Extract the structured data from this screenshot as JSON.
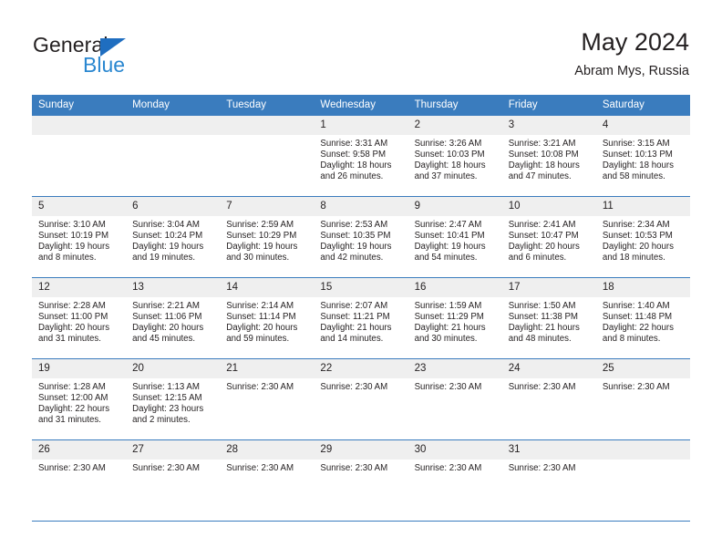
{
  "brand": {
    "word_one": "General",
    "word_two": "Blue",
    "triangle_color": "#1f6ec0",
    "blue_color": "#2a87d0"
  },
  "header": {
    "title": "May 2024",
    "subtitle": "Abram Mys, Russia"
  },
  "colors": {
    "header_bar": "#3a7cbe",
    "daynum_band": "#efefef",
    "text": "#231f20"
  },
  "weekday_headers": [
    "Sunday",
    "Monday",
    "Tuesday",
    "Wednesday",
    "Thursday",
    "Friday",
    "Saturday"
  ],
  "weeks": [
    [
      {
        "day": "",
        "lines": []
      },
      {
        "day": "",
        "lines": []
      },
      {
        "day": "",
        "lines": []
      },
      {
        "day": "1",
        "lines": [
          "Sunrise: 3:31 AM",
          "Sunset: 9:58 PM",
          "Daylight: 18 hours",
          "and 26 minutes."
        ]
      },
      {
        "day": "2",
        "lines": [
          "Sunrise: 3:26 AM",
          "Sunset: 10:03 PM",
          "Daylight: 18 hours",
          "and 37 minutes."
        ]
      },
      {
        "day": "3",
        "lines": [
          "Sunrise: 3:21 AM",
          "Sunset: 10:08 PM",
          "Daylight: 18 hours",
          "and 47 minutes."
        ]
      },
      {
        "day": "4",
        "lines": [
          "Sunrise: 3:15 AM",
          "Sunset: 10:13 PM",
          "Daylight: 18 hours",
          "and 58 minutes."
        ]
      }
    ],
    [
      {
        "day": "5",
        "lines": [
          "Sunrise: 3:10 AM",
          "Sunset: 10:19 PM",
          "Daylight: 19 hours",
          "and 8 minutes."
        ]
      },
      {
        "day": "6",
        "lines": [
          "Sunrise: 3:04 AM",
          "Sunset: 10:24 PM",
          "Daylight: 19 hours",
          "and 19 minutes."
        ]
      },
      {
        "day": "7",
        "lines": [
          "Sunrise: 2:59 AM",
          "Sunset: 10:29 PM",
          "Daylight: 19 hours",
          "and 30 minutes."
        ]
      },
      {
        "day": "8",
        "lines": [
          "Sunrise: 2:53 AM",
          "Sunset: 10:35 PM",
          "Daylight: 19 hours",
          "and 42 minutes."
        ]
      },
      {
        "day": "9",
        "lines": [
          "Sunrise: 2:47 AM",
          "Sunset: 10:41 PM",
          "Daylight: 19 hours",
          "and 54 minutes."
        ]
      },
      {
        "day": "10",
        "lines": [
          "Sunrise: 2:41 AM",
          "Sunset: 10:47 PM",
          "Daylight: 20 hours",
          "and 6 minutes."
        ]
      },
      {
        "day": "11",
        "lines": [
          "Sunrise: 2:34 AM",
          "Sunset: 10:53 PM",
          "Daylight: 20 hours",
          "and 18 minutes."
        ]
      }
    ],
    [
      {
        "day": "12",
        "lines": [
          "Sunrise: 2:28 AM",
          "Sunset: 11:00 PM",
          "Daylight: 20 hours",
          "and 31 minutes."
        ]
      },
      {
        "day": "13",
        "lines": [
          "Sunrise: 2:21 AM",
          "Sunset: 11:06 PM",
          "Daylight: 20 hours",
          "and 45 minutes."
        ]
      },
      {
        "day": "14",
        "lines": [
          "Sunrise: 2:14 AM",
          "Sunset: 11:14 PM",
          "Daylight: 20 hours",
          "and 59 minutes."
        ]
      },
      {
        "day": "15",
        "lines": [
          "Sunrise: 2:07 AM",
          "Sunset: 11:21 PM",
          "Daylight: 21 hours",
          "and 14 minutes."
        ]
      },
      {
        "day": "16",
        "lines": [
          "Sunrise: 1:59 AM",
          "Sunset: 11:29 PM",
          "Daylight: 21 hours",
          "and 30 minutes."
        ]
      },
      {
        "day": "17",
        "lines": [
          "Sunrise: 1:50 AM",
          "Sunset: 11:38 PM",
          "Daylight: 21 hours",
          "and 48 minutes."
        ]
      },
      {
        "day": "18",
        "lines": [
          "Sunrise: 1:40 AM",
          "Sunset: 11:48 PM",
          "Daylight: 22 hours",
          "and 8 minutes."
        ]
      }
    ],
    [
      {
        "day": "19",
        "lines": [
          "Sunrise: 1:28 AM",
          "Sunset: 12:00 AM",
          "Daylight: 22 hours",
          "and 31 minutes."
        ]
      },
      {
        "day": "20",
        "lines": [
          "Sunrise: 1:13 AM",
          "Sunset: 12:15 AM",
          "Daylight: 23 hours",
          "and 2 minutes."
        ]
      },
      {
        "day": "21",
        "lines": [
          "Sunrise: 2:30 AM"
        ]
      },
      {
        "day": "22",
        "lines": [
          "Sunrise: 2:30 AM"
        ]
      },
      {
        "day": "23",
        "lines": [
          "Sunrise: 2:30 AM"
        ]
      },
      {
        "day": "24",
        "lines": [
          "Sunrise: 2:30 AM"
        ]
      },
      {
        "day": "25",
        "lines": [
          "Sunrise: 2:30 AM"
        ]
      }
    ],
    [
      {
        "day": "26",
        "lines": [
          "Sunrise: 2:30 AM"
        ]
      },
      {
        "day": "27",
        "lines": [
          "Sunrise: 2:30 AM"
        ]
      },
      {
        "day": "28",
        "lines": [
          "Sunrise: 2:30 AM"
        ]
      },
      {
        "day": "29",
        "lines": [
          "Sunrise: 2:30 AM"
        ]
      },
      {
        "day": "30",
        "lines": [
          "Sunrise: 2:30 AM"
        ]
      },
      {
        "day": "31",
        "lines": [
          "Sunrise: 2:30 AM"
        ]
      },
      {
        "day": "",
        "lines": []
      }
    ]
  ]
}
